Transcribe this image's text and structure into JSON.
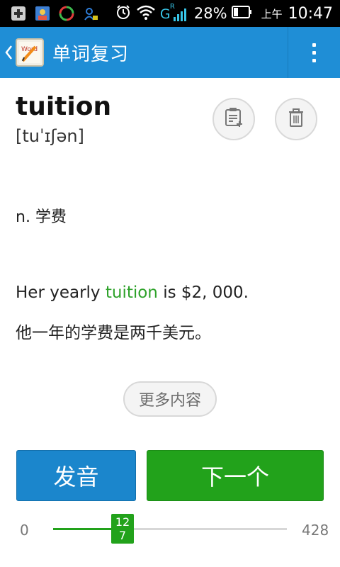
{
  "status_bar": {
    "battery_percent": "28%",
    "time_prefix": "上午",
    "time": "10:47",
    "network_label": "G",
    "network_sup": "R"
  },
  "action_bar": {
    "title": "单词复习"
  },
  "word": {
    "text": "tuition",
    "phonetic": "[tuˈɪʃən]"
  },
  "meaning": "n. 学费",
  "example": {
    "en_before": "Her yearly ",
    "en_highlight": "tuition",
    "en_after": " is $2, 000.",
    "cn": "他一年的学费是两千美元。"
  },
  "buttons": {
    "more": "更多内容",
    "pronounce": "发音",
    "next": "下一个"
  },
  "progress": {
    "min": "0",
    "max": "428",
    "current": 127,
    "current_line1": "12",
    "current_line2": "7"
  },
  "colors": {
    "accent_blue": "#1f8ed6",
    "accent_green": "#22a21b"
  }
}
